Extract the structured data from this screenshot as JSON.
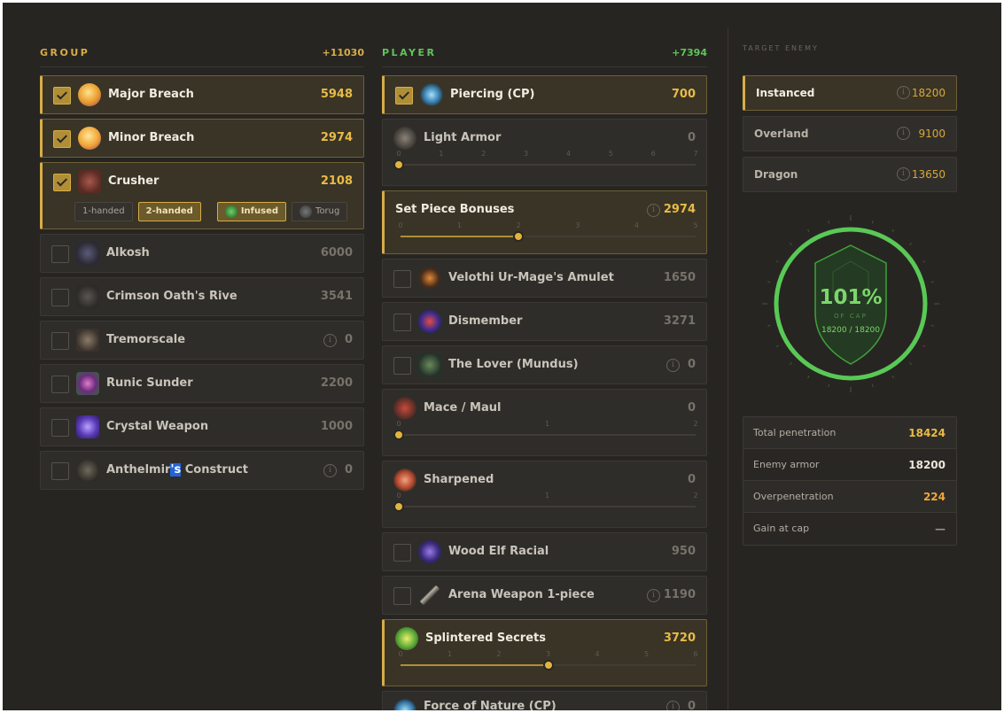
{
  "group": {
    "title": "GROUP",
    "total": "+11030",
    "items": [
      {
        "name": "Major Breach",
        "value": "5948",
        "checked": true
      },
      {
        "name": "Minor Breach",
        "value": "2974",
        "checked": true
      },
      {
        "name": "Crusher",
        "value": "2108",
        "checked": true
      },
      {
        "name": "Alkosh",
        "value": "6000",
        "checked": false
      },
      {
        "name": "Crimson Oath's Rive",
        "value": "3541",
        "checked": false
      },
      {
        "name": "Tremorscale",
        "value": "0",
        "checked": false
      },
      {
        "name": "Runic Sunder",
        "value": "2200",
        "checked": false
      },
      {
        "name": "Crystal Weapon",
        "value": "1000",
        "checked": false
      },
      {
        "name_before": "Anthelmir",
        "name_highlight": "'s",
        "name_after": " Construct",
        "value": "0",
        "checked": false
      }
    ],
    "crusher_options": [
      "1-handed",
      "2-handed",
      "Infused",
      "Torug"
    ]
  },
  "player": {
    "title": "PLAYER",
    "total": "+7394",
    "items": [
      {
        "name": "Piercing (CP)",
        "value": "700",
        "checked": true
      },
      {
        "name": "Light Armor",
        "value": "0",
        "ticks": [
          "0",
          "1",
          "2",
          "3",
          "4",
          "5",
          "6",
          "7"
        ],
        "level": 0
      },
      {
        "name": "Set Piece Bonuses",
        "value": "2974",
        "ticks": [
          "0",
          "1",
          "2",
          "3",
          "4",
          "5"
        ],
        "level": 2
      },
      {
        "name": "Velothi Ur-Mage's Amulet",
        "value": "1650",
        "checked": false
      },
      {
        "name": "Dismember",
        "value": "3271",
        "checked": false
      },
      {
        "name": "The Lover (Mundus)",
        "value": "0",
        "checked": false
      },
      {
        "name": "Mace / Maul",
        "value": "0",
        "ticks": [
          "0",
          "1",
          "2"
        ],
        "level": 0
      },
      {
        "name": "Sharpened",
        "value": "0",
        "ticks": [
          "0",
          "1",
          "2"
        ],
        "level": 0
      },
      {
        "name": "Wood Elf Racial",
        "value": "950",
        "checked": false
      },
      {
        "name": "Arena Weapon 1-piece",
        "value": "1190",
        "checked": false
      },
      {
        "name": "Splintered Secrets",
        "value": "3720",
        "ticks": [
          "0",
          "1",
          "2",
          "3",
          "4",
          "5",
          "6"
        ],
        "level": 3
      },
      {
        "name": "Force of Nature (CP)",
        "value": "0"
      }
    ]
  },
  "target": {
    "title": "TARGET ENEMY",
    "options": [
      {
        "name": "Instanced",
        "value": "18200",
        "selected": true
      },
      {
        "name": "Overland",
        "value": "9100",
        "selected": false
      },
      {
        "name": "Dragon",
        "value": "13650",
        "selected": false
      }
    ],
    "gauge": {
      "percent": "101%",
      "caption": "OF CAP",
      "ratio": "18200 / 18200",
      "fraction": 1.0
    },
    "stats": [
      {
        "label": "Total penetration",
        "value": "18424",
        "color": "#e9bb46"
      },
      {
        "label": "Enemy armor",
        "value": "18200",
        "color": "#ece7dc"
      },
      {
        "label": "Overpenetration",
        "value": "224",
        "color": "#f0a63a"
      },
      {
        "label": "Gain at cap",
        "value": "—",
        "color": "#9a948a"
      }
    ]
  },
  "colors": {
    "accent": "#d7ad46",
    "player": "#5fc55a",
    "gauge": "#59c956"
  },
  "icons": {
    "info": "i",
    "checkbox": "checkmark-icon"
  }
}
